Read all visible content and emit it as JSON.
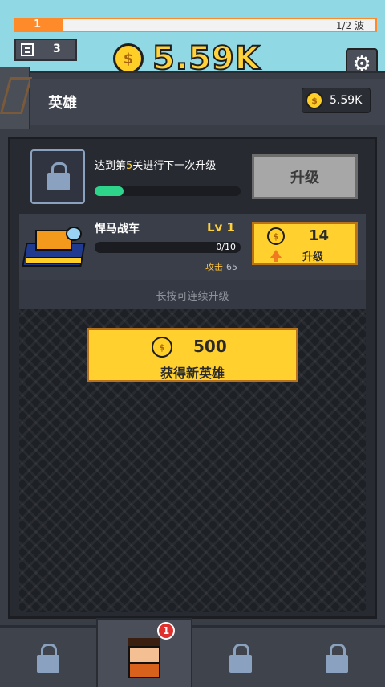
{
  "top": {
    "wave_level": "1",
    "wave_count": "1/2 波",
    "wave_progress": 0.13,
    "stage": "3",
    "gold": "5.59K"
  },
  "panel": {
    "title": "英雄",
    "gold": "5.59K"
  },
  "unlock": {
    "text_pre": "达到第",
    "text_num": "5",
    "text_post": "关进行下一次升级",
    "progress": 0.2,
    "button_label": "升级"
  },
  "hero": {
    "name": "悍马战车",
    "level": "Lv 1",
    "progress_text": "0/10",
    "attack_label": "攻击",
    "attack_value": "65",
    "upgrade_cost": "14",
    "upgrade_label": "升级"
  },
  "hint": "长按可连续升级",
  "get_hero": {
    "cost": "500",
    "label": "获得新英雄"
  },
  "nav": {
    "badge": "1",
    "tabs": [
      "locked",
      "heroes",
      "locked",
      "locked"
    ]
  },
  "colors": {
    "accent_orange": "#ff8a2a",
    "gold": "#ffd23c",
    "button_yellow": "#ffd02e",
    "progress_green": "#2ed48a"
  }
}
